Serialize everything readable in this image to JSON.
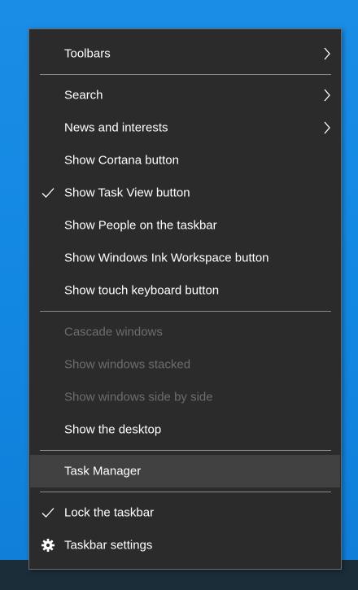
{
  "menu": {
    "toolbars": "Toolbars",
    "search": "Search",
    "news": "News and interests",
    "cortana": "Show Cortana button",
    "task_view": "Show Task View button",
    "people": "Show People on the taskbar",
    "ink": "Show Windows Ink Workspace button",
    "touch_keyboard": "Show touch keyboard button",
    "cascade": "Cascade windows",
    "stacked": "Show windows stacked",
    "side_by_side": "Show windows side by side",
    "desktop": "Show the desktop",
    "task_manager": "Task Manager",
    "lock": "Lock the taskbar",
    "settings": "Taskbar settings"
  },
  "states": {
    "task_view_checked": true,
    "lock_checked": true,
    "hovered_item": "Task Manager",
    "disabled_items": [
      "Cascade windows",
      "Show windows stacked",
      "Show windows side by side"
    ]
  },
  "colors": {
    "menu_bg": "#2b2b2b",
    "text": "#ffffff",
    "disabled_text": "#6d6d6d",
    "hover_bg": "#414141",
    "desktop_blue": "#1a8ee6"
  },
  "icons": {
    "submenu": "chevron-right-icon",
    "check": "checkmark-icon",
    "settings": "gear-icon"
  }
}
